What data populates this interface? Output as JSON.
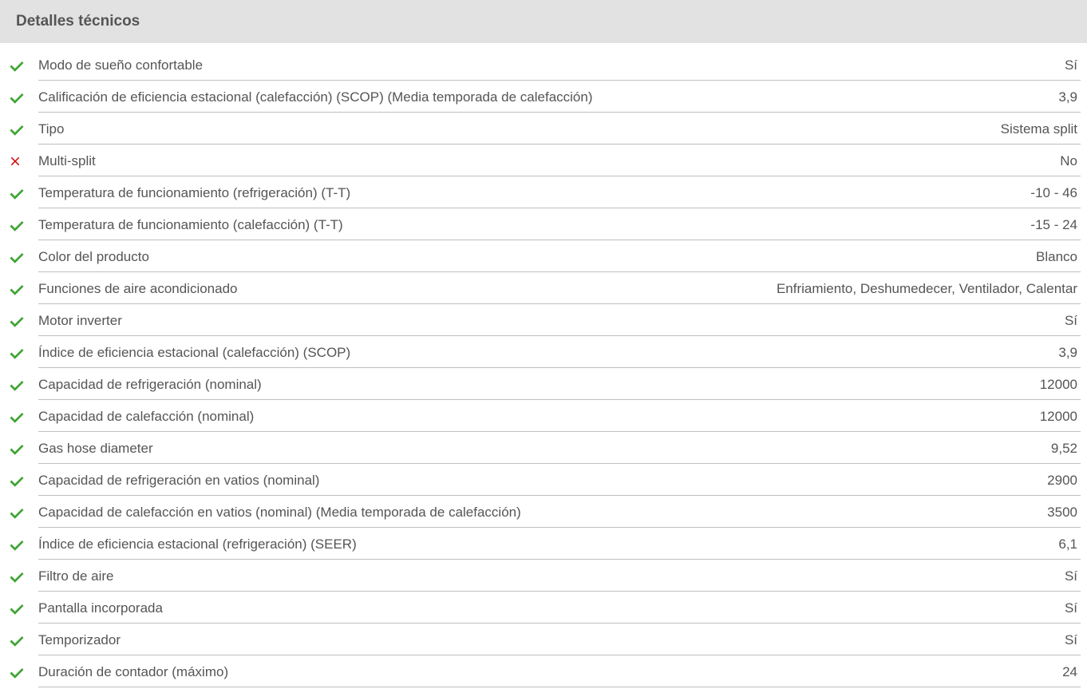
{
  "section_title": "Detalles técnicos",
  "colors": {
    "check": "#3fa535",
    "cross": "#d40000"
  },
  "specs": [
    {
      "status": "yes",
      "label": "Modo de sueño confortable",
      "value": "Sí"
    },
    {
      "status": "yes",
      "label": "Calificación de eficiencia estacional (calefacción) (SCOP) (Media temporada de calefacción)",
      "value": "3,9"
    },
    {
      "status": "yes",
      "label": "Tipo",
      "value": "Sistema split"
    },
    {
      "status": "no",
      "label": "Multi-split",
      "value": "No"
    },
    {
      "status": "yes",
      "label": "Temperatura de funcionamiento (refrigeración) (T-T)",
      "value": "-10 - 46"
    },
    {
      "status": "yes",
      "label": "Temperatura de funcionamiento (calefacción) (T-T)",
      "value": "-15 - 24"
    },
    {
      "status": "yes",
      "label": "Color del producto",
      "value": "Blanco"
    },
    {
      "status": "yes",
      "label": "Funciones de aire acondicionado",
      "value": "Enfriamiento, Deshumedecer, Ventilador, Calentar"
    },
    {
      "status": "yes",
      "label": "Motor inverter",
      "value": "Sí"
    },
    {
      "status": "yes",
      "label": "Índice de eficiencia estacional (calefacción) (SCOP)",
      "value": "3,9"
    },
    {
      "status": "yes",
      "label": "Capacidad de refrigeración (nominal)",
      "value": "12000"
    },
    {
      "status": "yes",
      "label": "Capacidad de calefacción (nominal)",
      "value": "12000"
    },
    {
      "status": "yes",
      "label": "Gas hose diameter",
      "value": "9,52"
    },
    {
      "status": "yes",
      "label": "Capacidad de refrigeración en vatios (nominal)",
      "value": "2900"
    },
    {
      "status": "yes",
      "label": "Capacidad de calefacción en vatios (nominal) (Media temporada de calefacción)",
      "value": "3500"
    },
    {
      "status": "yes",
      "label": "Índice de eficiencia estacional (refrigeración) (SEER)",
      "value": "6,1"
    },
    {
      "status": "yes",
      "label": "Filtro de aire",
      "value": "Sí"
    },
    {
      "status": "yes",
      "label": "Pantalla incorporada",
      "value": "Sí"
    },
    {
      "status": "yes",
      "label": "Temporizador",
      "value": "Sí"
    },
    {
      "status": "yes",
      "label": "Duración de contador (máximo)",
      "value": "24"
    }
  ]
}
